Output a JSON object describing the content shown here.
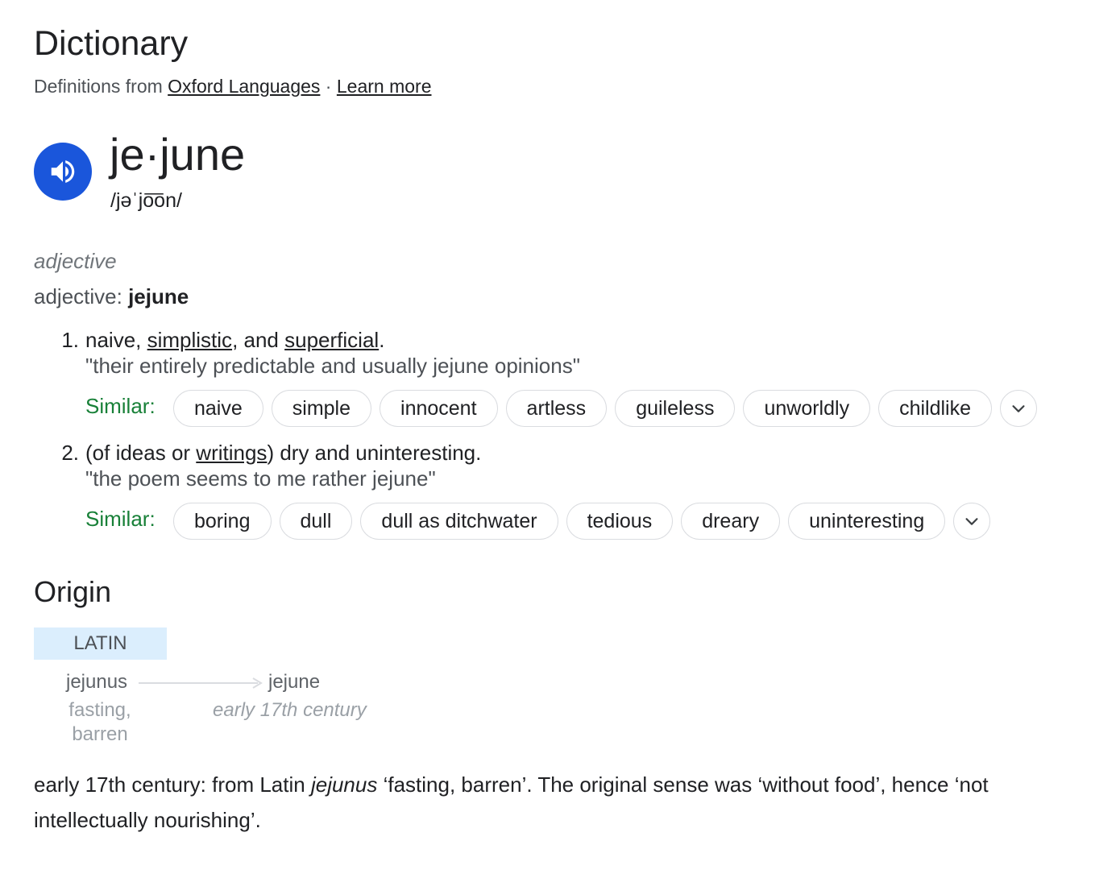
{
  "header": {
    "title": "Dictionary",
    "source_prefix": "Definitions from ",
    "source_link": "Oxford Languages",
    "separator": " · ",
    "learn_more": "Learn more"
  },
  "entry": {
    "headword": "je·june",
    "phonetic": "/jəˈjo͞on/",
    "pos_label": "adjective",
    "pos_prefix": "adjective: ",
    "pos_word": "jejune"
  },
  "senses": [
    {
      "number": "1.",
      "def_parts": [
        "naive, ",
        "simplistic",
        ", and ",
        "superficial",
        "."
      ],
      "example": "\"their entirely predictable and usually jejune opinions\"",
      "similar_label": "Similar:",
      "similar": [
        "naive",
        "simple",
        "innocent",
        "artless",
        "guileless",
        "unworldly",
        "childlike"
      ]
    },
    {
      "number": "2.",
      "def_parts": [
        "(of ideas or ",
        "writings",
        ") dry and uninteresting."
      ],
      "example": "\"the poem seems to me rather jejune\"",
      "similar_label": "Similar:",
      "similar": [
        "boring",
        "dull",
        "dull as ditchwater",
        "tedious",
        "dreary",
        "uninteresting"
      ]
    }
  ],
  "origin": {
    "heading": "Origin",
    "language": "LATIN",
    "source_word": "jejunus",
    "source_gloss_1": "fasting,",
    "source_gloss_2": "barren",
    "target_word": "jejune",
    "target_date": "early 17th century",
    "text_before": "early 17th century: from Latin ",
    "text_italic": "jejunus",
    "text_after": " ‘fasting, barren’. The original sense was ‘without food’, hence ‘not intellectually nourishing’."
  },
  "colors": {
    "speaker_button": "#1a56db",
    "similar_label": "#188038",
    "language_box": "#dbeefd"
  },
  "icons": {
    "speaker": "speaker-icon",
    "expand": "chevron-down-icon"
  }
}
